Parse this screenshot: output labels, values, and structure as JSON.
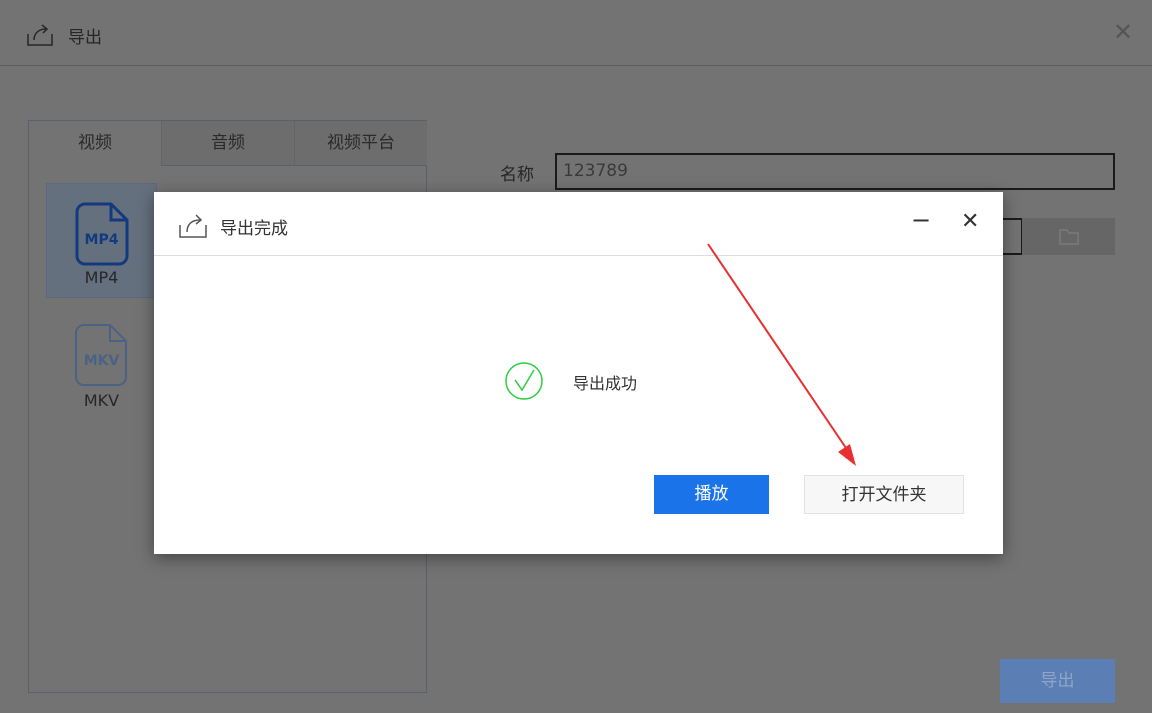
{
  "window": {
    "title": "导出"
  },
  "tabs": [
    {
      "label": "视频"
    },
    {
      "label": "音频"
    },
    {
      "label": "视频平台"
    }
  ],
  "formats": [
    {
      "icon_text": "MP4",
      "label": "MP4"
    },
    {
      "icon_text": "MKV",
      "label": "MKV"
    }
  ],
  "form": {
    "name_label": "名称",
    "name_value": "123789"
  },
  "export_button": "导出",
  "dialog": {
    "title": "导出完成",
    "message": "导出成功",
    "play_button": "播放",
    "open_folder_button": "打开文件夹"
  },
  "colors": {
    "accent": "#1a73e8",
    "success": "#2ecc40",
    "arrow": "#e83030"
  }
}
